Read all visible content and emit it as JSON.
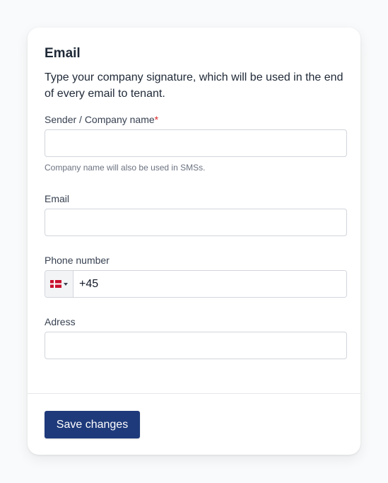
{
  "card": {
    "title": "Email",
    "description": "Type your company signature, which will be used in the end of every email to tenant."
  },
  "fields": {
    "company_name": {
      "label": "Sender / Company name",
      "required_marker": "*",
      "value": "",
      "help": "Company name will also be used in SMSs."
    },
    "email": {
      "label": "Email",
      "value": ""
    },
    "phone": {
      "label": "Phone number",
      "country_flag": "denmark-flag-icon",
      "value": "+45"
    },
    "address": {
      "label": "Adress",
      "value": ""
    }
  },
  "actions": {
    "save_label": "Save changes"
  },
  "colors": {
    "primary_button": "#1e3a7b",
    "required": "#dc2626",
    "flag_red": "#c8102e",
    "flag_white": "#ffffff"
  }
}
